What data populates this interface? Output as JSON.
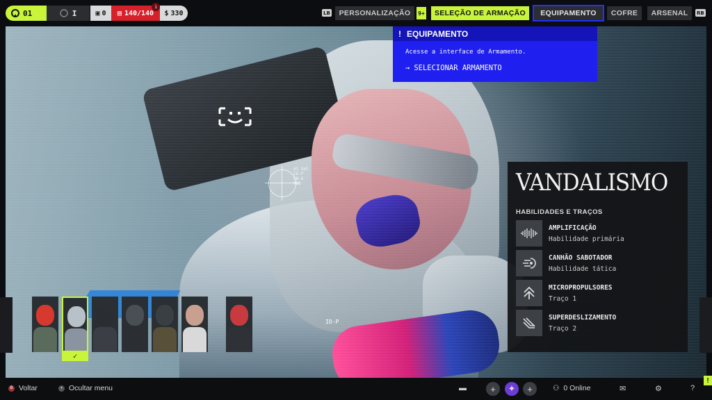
{
  "topbar": {
    "level": "01",
    "rank": "I",
    "tokens": "0",
    "hp": "140/140",
    "hp_badge": "1",
    "credits": "330",
    "lb_key": "LB",
    "rb_key": "RB",
    "nav": {
      "personalizacao": "PERSONALIZAÇÃO",
      "personalizacao_badge": "9+",
      "selecao": "SELEÇÃO DE ARMAÇÃO",
      "equipamento": "EQUIPAMENTO",
      "cofre": "COFRE",
      "arsenal": "ARSENAL"
    }
  },
  "tooltip": {
    "title": "EQUIPAMENTO",
    "description": "Acesse a interface de Armamento.",
    "action": "SELECIONAR ARMAMENTO"
  },
  "scene": {
    "reticle_text": "A1 Set\nID-P\nSN-6\nMOD",
    "id_label": "ID-P"
  },
  "panel": {
    "title": "VANDALISMO",
    "subtitle": "HABILIDADES E TRAÇOS",
    "abilities": [
      {
        "name": "AMPLIFICAÇÃO",
        "type": "Habilidade primária",
        "icon": "soundwave-icon"
      },
      {
        "name": "CANHÃO SABOTADOR",
        "type": "Habilidade tática",
        "icon": "cannon-icon"
      },
      {
        "name": "MICROPROPULSORES",
        "type": "Traço 1",
        "icon": "thrusters-icon"
      },
      {
        "name": "SUPERDESLIZAMENTO",
        "type": "Traço 2",
        "icon": "slide-icon"
      }
    ]
  },
  "roster": {
    "agents": [
      {
        "name": "agent-1",
        "head": "#d8392e",
        "torso": "#5a6b5c"
      },
      {
        "name": "agent-2",
        "head": "#b8c0c8",
        "torso": "#8a93a0",
        "selected": true
      },
      {
        "name": "agent-3",
        "head": "#2a2e33",
        "torso": "#3b3f45"
      },
      {
        "name": "agent-4",
        "head": "#4a4f55",
        "torso": "#2b2f33"
      },
      {
        "name": "agent-5",
        "head": "#3a3f44",
        "torso": "#59503a"
      },
      {
        "name": "agent-6",
        "head": "#c9a090",
        "torso": "#d9d9d9"
      },
      {
        "name": "agent-7",
        "head": "#c63a40",
        "torso": "#2e3237"
      }
    ]
  },
  "bottombar": {
    "back": "Voltar",
    "hide_menu": "Ocultar menu",
    "online": "0 Online"
  },
  "colors": {
    "accent_lime": "#c8f53a",
    "accent_blue": "#1f1fef",
    "hp_red": "#d6202a"
  }
}
